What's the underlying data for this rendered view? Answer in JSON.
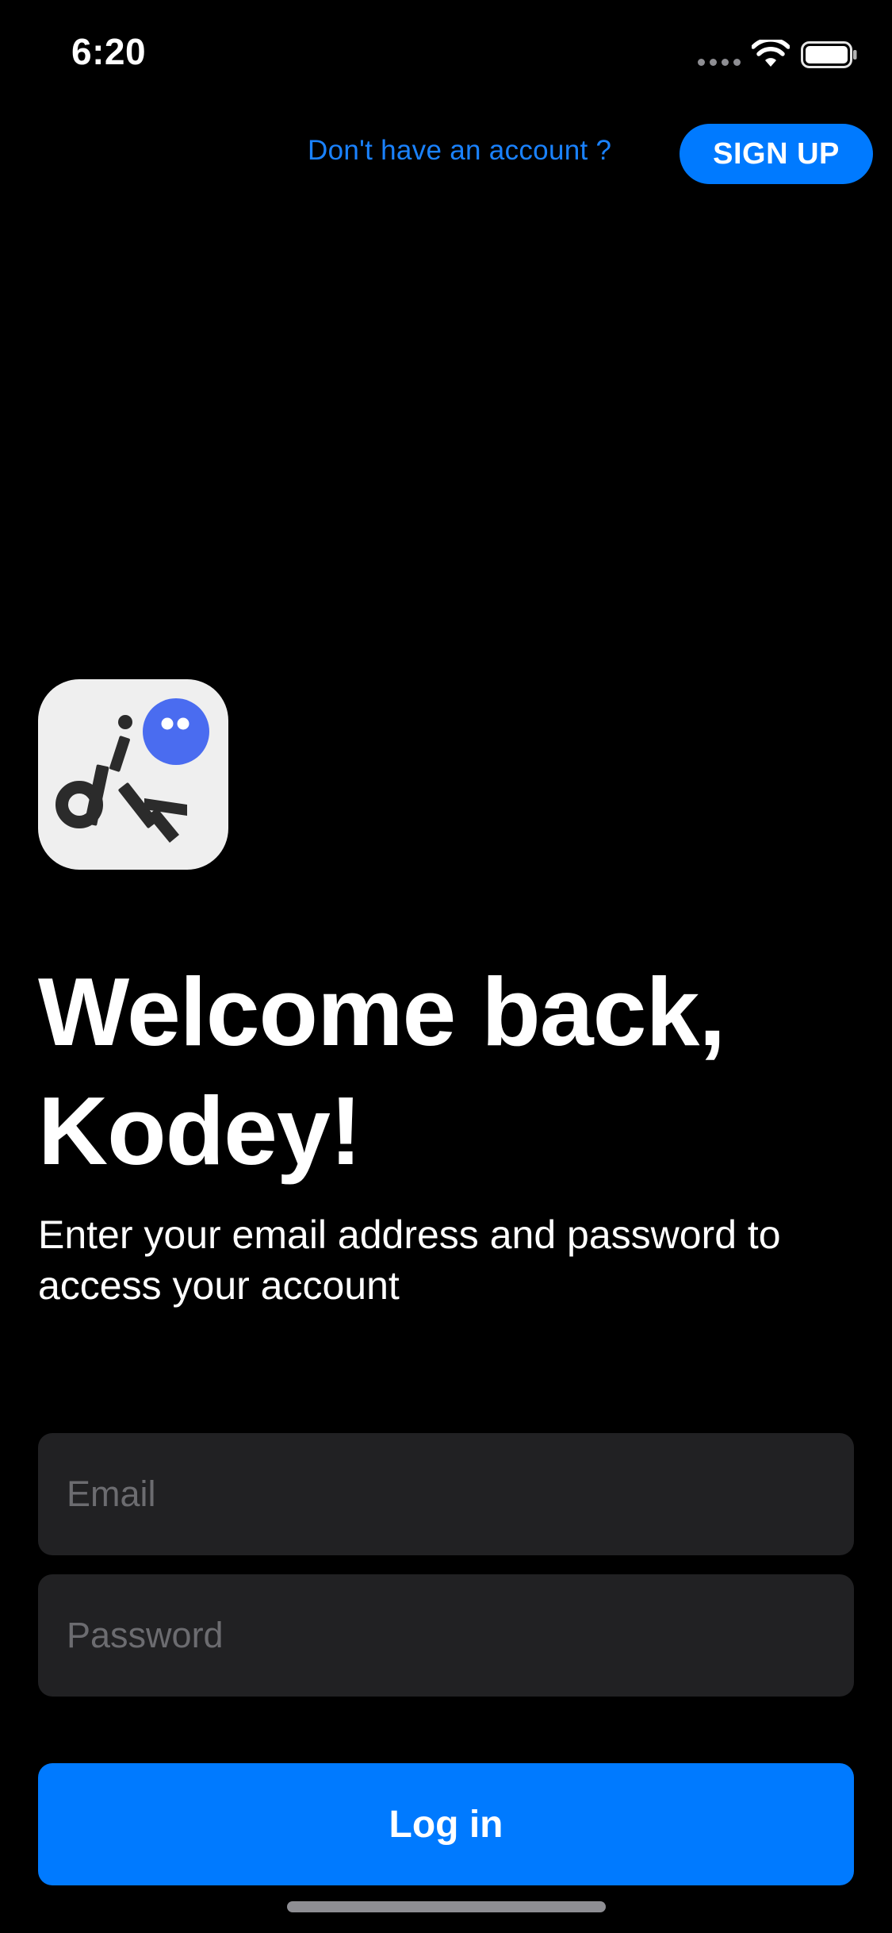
{
  "status_bar": {
    "time": "6:20"
  },
  "header": {
    "signup_prompt": "Don't have an account ?",
    "signup_button_label": "SIGN UP"
  },
  "logo": {
    "letters": "dik",
    "icon_name": "app-logo-icon"
  },
  "main": {
    "title": "Welcome back, Kodey!",
    "subtitle": "Enter your email address and password to access your account"
  },
  "form": {
    "email_placeholder": "Email",
    "email_value": "",
    "password_placeholder": "Password",
    "password_value": "",
    "login_button_label": "Log in"
  },
  "colors": {
    "background": "#000000",
    "accent": "#007aff",
    "link": "#1a82ff",
    "field_background": "#212123",
    "placeholder": "#6c6c70",
    "logo_bubble": "#4a6cf0"
  }
}
